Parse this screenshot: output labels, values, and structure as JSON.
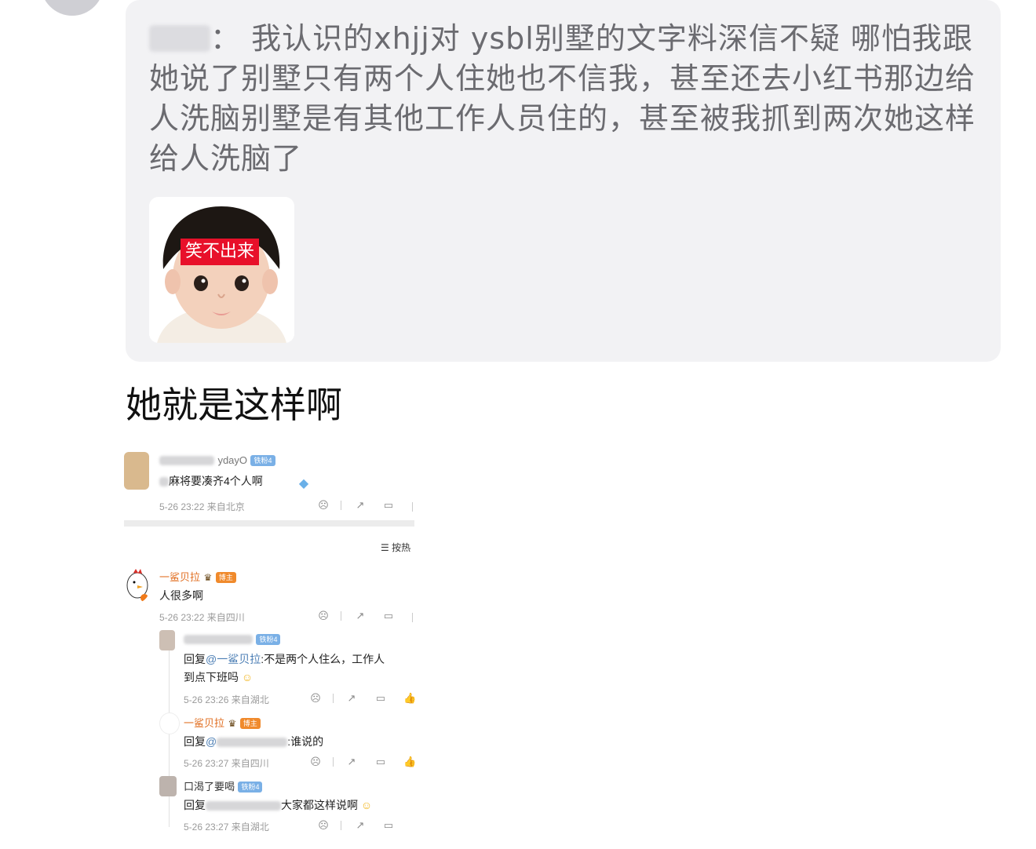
{
  "quote": {
    "separator": "：",
    "text": "我认识的xhjj对 ysbl别墅的文字料深信不疑 哪怕我跟她说了别墅只有两个人住她也不信我，甚至还去小红书那边给人洗脑别墅是有其他工作人员住的，甚至被我抓到两次她这样给人洗脑了",
    "image_caption": "笑不出来"
  },
  "post_text": "她就是这样啊",
  "screenshot": {
    "comment1": {
      "username": "ydayO",
      "badge": "铁粉4",
      "body": "麻将要凑齐4个人啊",
      "meta": "5-26 23:22  来自北京"
    },
    "sort_label": "按热",
    "comment2": {
      "username": "一鲨贝拉",
      "badge": "博主",
      "body": "人很多啊",
      "meta": "5-26 23:22  来自四川"
    },
    "replies": [
      {
        "username": "",
        "badge": "铁粉4",
        "reply_prefix": "回复",
        "mention": "@一鲨贝拉",
        "body": ":不是两个人住么，工作人",
        "body2": "到点下班吗",
        "meta": "5-26 23:26  来自湖北"
      },
      {
        "username": "一鲨贝拉",
        "badge": "博主",
        "reply_prefix": "回复",
        "mention": "@",
        "body": ":谁说的",
        "meta": "5-26 23:27  来自四川"
      },
      {
        "username": "口渴了要喝",
        "badge": "铁粉4",
        "reply_prefix": "回复",
        "body": "大家都这样说啊",
        "meta": "5-26 23:27  来自湖北"
      }
    ]
  },
  "colors": {
    "card_bg": "#f2f2f4",
    "quote_text": "#6b6b70",
    "name_orange": "#e06d1f",
    "link_blue": "#4d7fb5",
    "banner_red": "#e8102a"
  }
}
